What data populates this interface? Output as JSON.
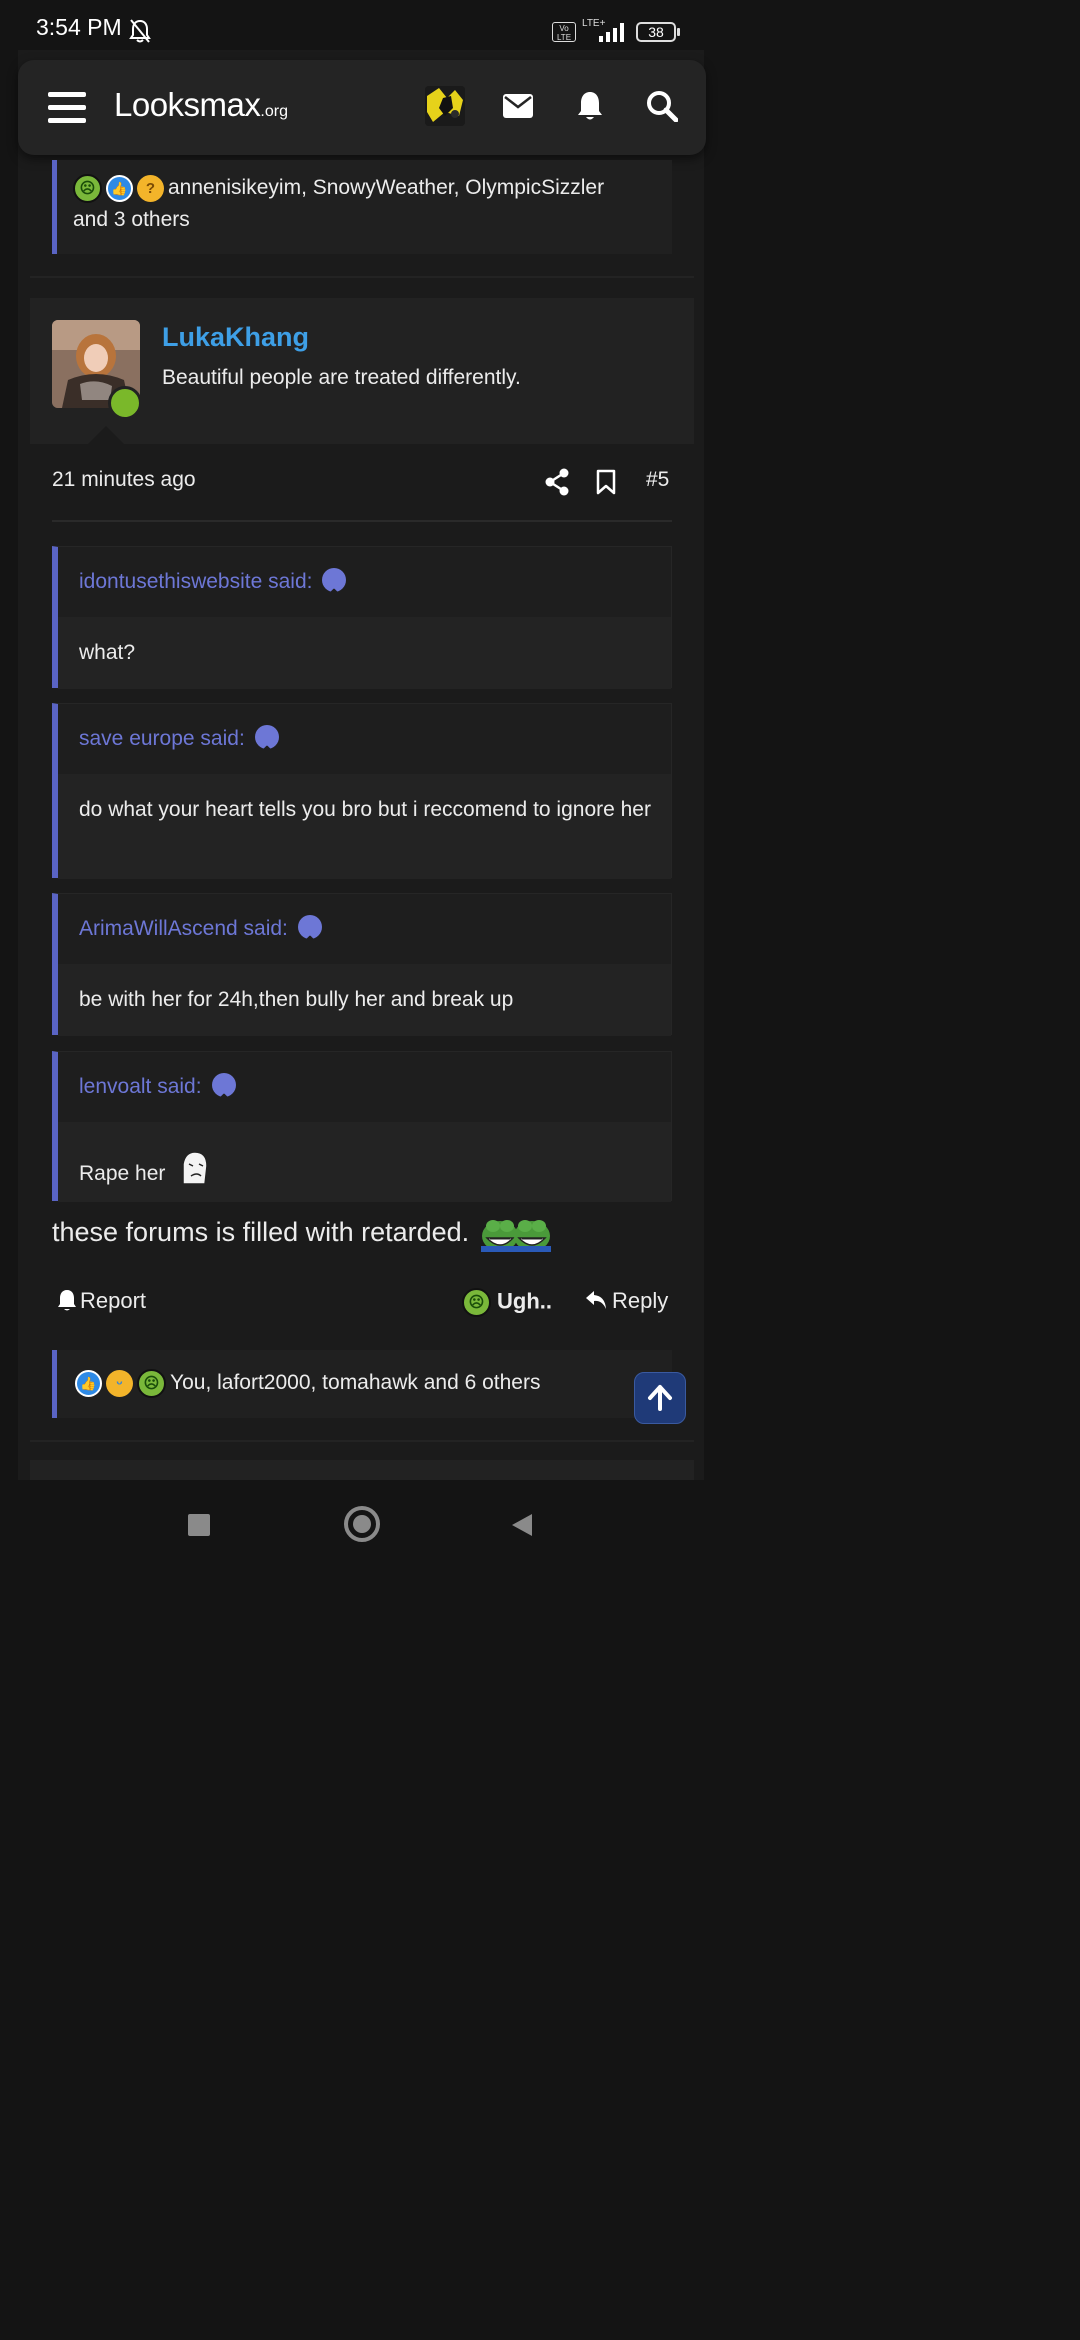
{
  "status_bar": {
    "time": "3:54 PM",
    "volte": "Vo LTE",
    "network": "LTE+",
    "battery": "38"
  },
  "header": {
    "logo_main": "Lᴏᴏksmax",
    "logo_suffix": ".org"
  },
  "top_reactions": {
    "text_line1": "annenisikeyim, SnowyWeather, OlympicSizzler",
    "text_line2": "and 3 others"
  },
  "post": {
    "author": "LukaKhang",
    "author_title": "Beautiful people are treated differently.",
    "time": "21 minutes ago",
    "number": "#5",
    "quotes": [
      {
        "author": "idontusethiswebsite said:",
        "text": "what?"
      },
      {
        "author": "save europe said:",
        "text": "do what your heart tells you bro but i reccomend to ignore her"
      },
      {
        "author": "ArimaWillAscend said:",
        "text": "be with her for 24h,then bully her and break up"
      },
      {
        "author": "lenvoalt said:",
        "text": "Rape her"
      }
    ],
    "body": "these forums is filled with retarded.",
    "actions": {
      "report": "Report",
      "reaction": "Ugh..",
      "reply": "Reply"
    },
    "reactions_text": "You, lafort2000, tomahawk and 6 others"
  },
  "colors": {
    "accent_link": "#3e9fe6",
    "quote_border": "#5a64c4",
    "quote_author": "#6d77d6",
    "online": "#7ab82a"
  }
}
